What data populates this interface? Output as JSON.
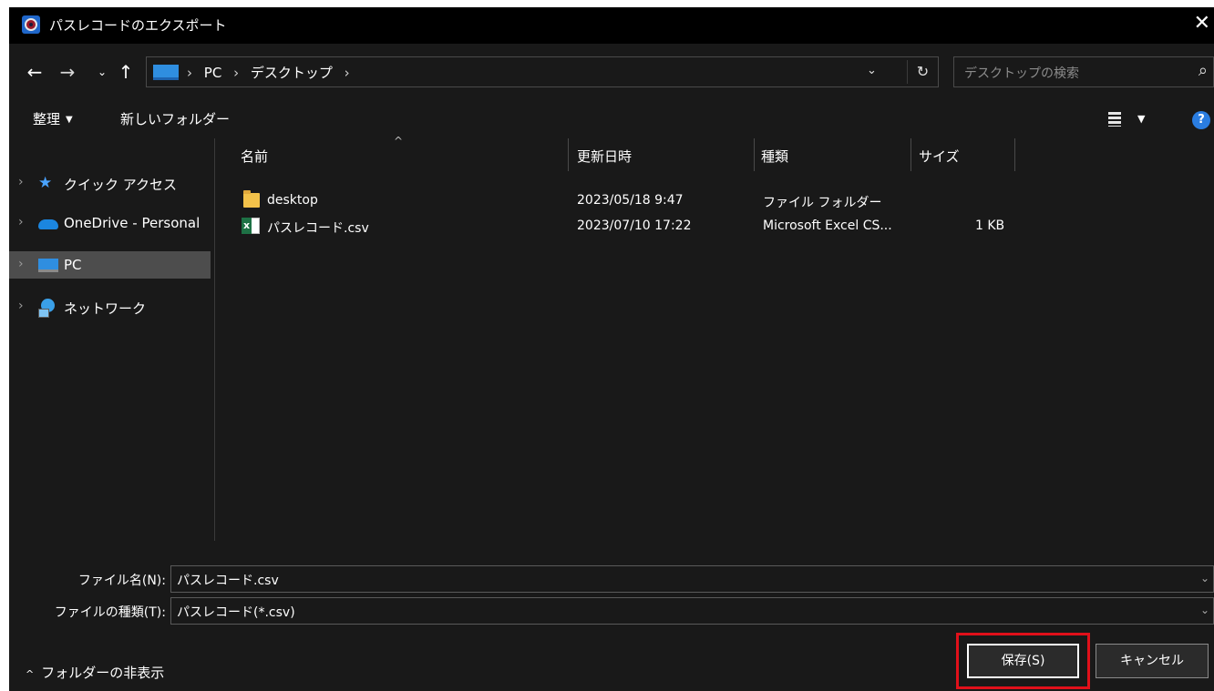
{
  "window": {
    "title": "パスレコードのエクスポート",
    "close_glyph": "✕"
  },
  "nav": {
    "back": "←",
    "forward": "→",
    "recent": "⌄",
    "up": "↑"
  },
  "address": {
    "crumbs": [
      "PC",
      "デスクトップ"
    ],
    "separator": "›",
    "dropdown_glyph": "⌄",
    "refresh_glyph": "↻"
  },
  "search": {
    "placeholder": "デスクトップの検索",
    "icon_glyph": "⌕"
  },
  "toolbar": {
    "organize_label": "整理",
    "organize_caret": "▼",
    "new_folder_label": "新しいフォルダー",
    "view_caret": "▼",
    "help_glyph": "?"
  },
  "sidebar": {
    "items": [
      {
        "label": "クイック アクセス",
        "icon": "star-icon",
        "selected": false
      },
      {
        "label": "OneDrive - Personal",
        "icon": "cloud-icon",
        "selected": false
      },
      {
        "label": "PC",
        "icon": "computer-icon",
        "selected": true
      },
      {
        "label": "ネットワーク",
        "icon": "network-icon",
        "selected": false
      }
    ],
    "chevron": "›"
  },
  "files": {
    "sort_caret": "^",
    "columns": [
      "名前",
      "更新日時",
      "種類",
      "サイズ"
    ],
    "rows": [
      {
        "name": "desktop",
        "modified": "2023/05/18 9:47",
        "type": "ファイル フォルダー",
        "size": "",
        "icon": "folder-icon"
      },
      {
        "name": "パスレコード.csv",
        "modified": "2023/07/10 17:22",
        "type": "Microsoft Excel CS...",
        "size": "1 KB",
        "icon": "excel-file-icon"
      }
    ]
  },
  "form": {
    "filename_label": "ファイル名(N):",
    "filename_value": "パスレコード.csv",
    "filetype_label": "ファイルの種類(T):",
    "filetype_value": "パスレコード(*.csv)",
    "dropdown_glyph": "⌄"
  },
  "footer": {
    "hide_folders_label": "フォルダーの非表示",
    "hide_caret": "^",
    "save_label": "保存(S)",
    "cancel_label": "キャンセル"
  },
  "colors": {
    "background": "#191919",
    "titlebar": "#000000",
    "selected_item": "#4d4d4d",
    "highlight_border": "#e0101a",
    "accent": "#2a7de1"
  }
}
